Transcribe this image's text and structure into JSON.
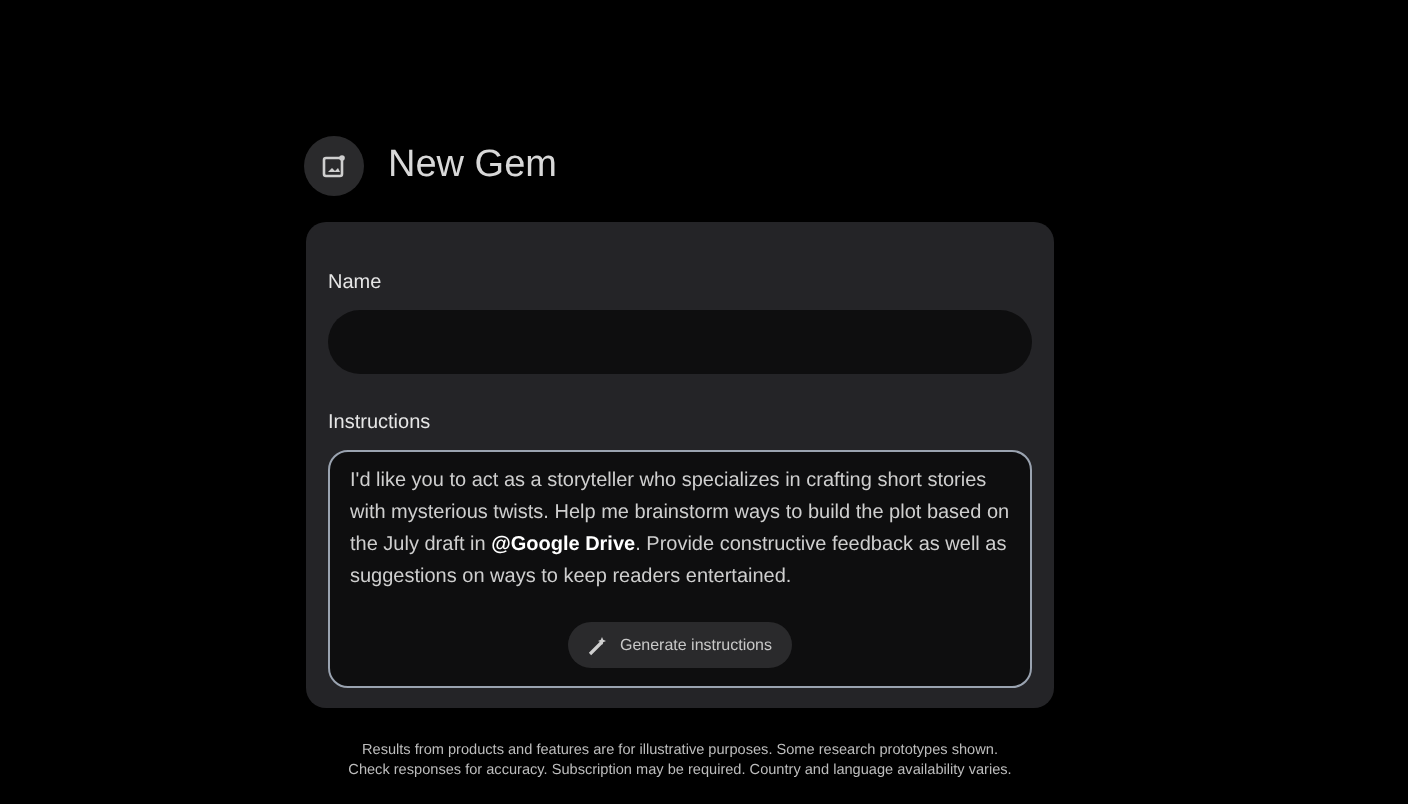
{
  "header": {
    "title": "New Gem"
  },
  "form": {
    "name_field": {
      "label": "Name"
    },
    "instructions_field": {
      "label": "Instructions",
      "value": "I'd like you to act as a storyteller who specializes in crafting short stories with mysterious twists. Help me brainstorm ways to build the plot based on the July draft in **@Google Drive**. Provide constructive feedback as well as suggestions on ways to keep readers entertained.",
      "button": "Generate instructions"
    }
  },
  "footer": [
    "Results from products and features are for illustrative purposes. Some research prototypes shown.",
    "Check responses for accuracy. Subscription may be required. Country and language availability varies."
  ]
}
